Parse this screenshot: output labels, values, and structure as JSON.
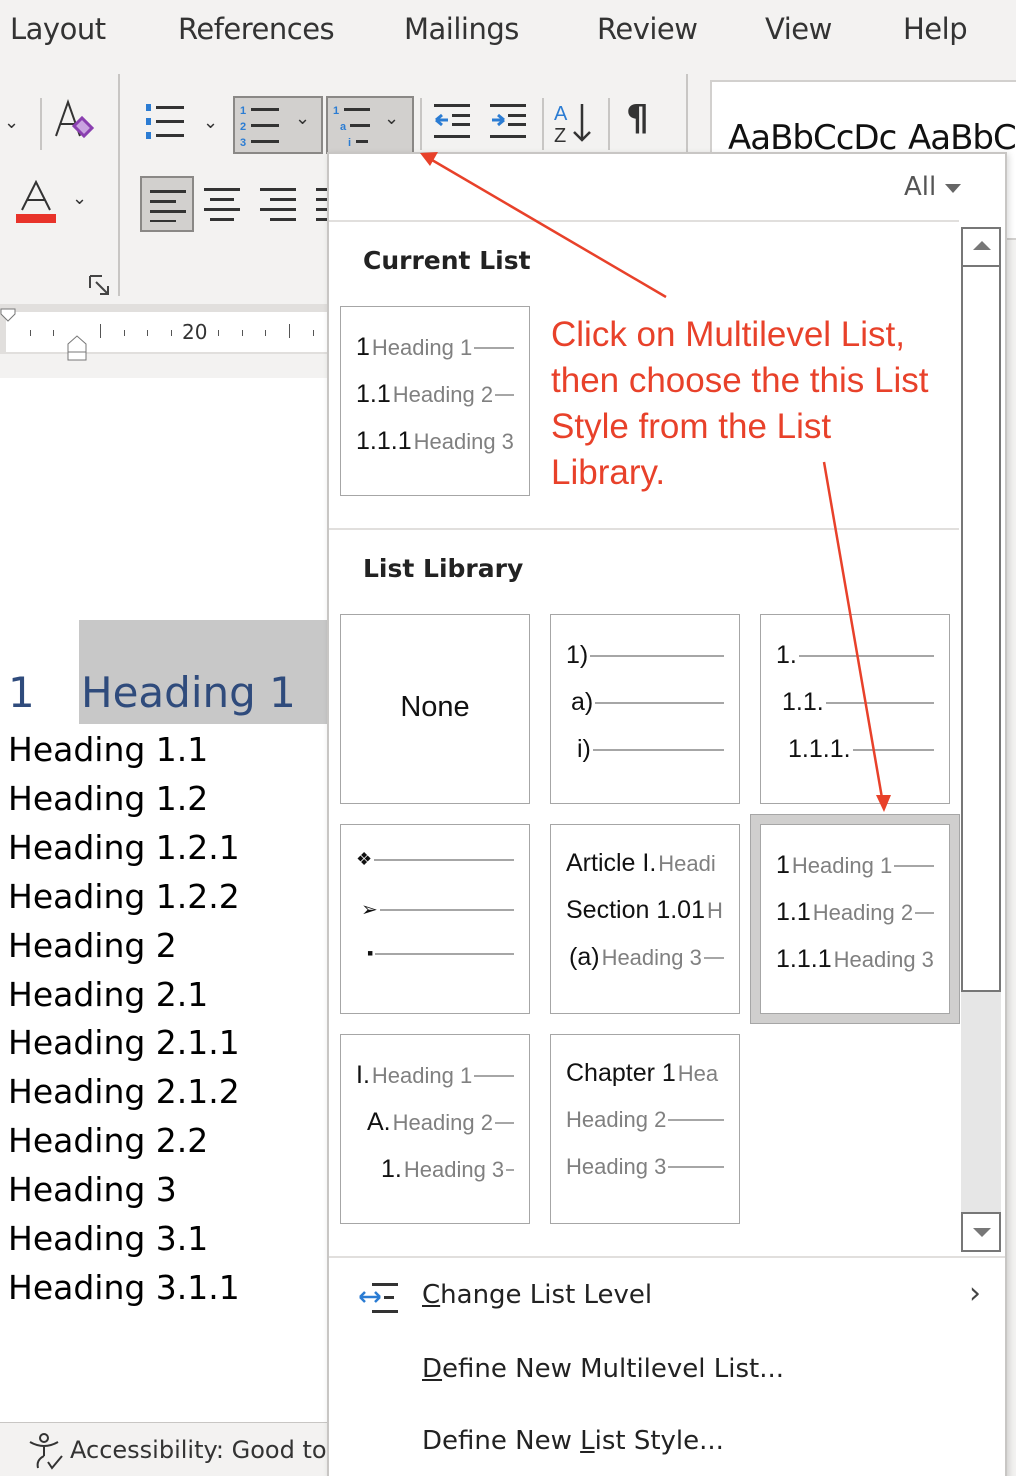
{
  "ribbon_tabs": [
    "Layout",
    "References",
    "Mailings",
    "Review",
    "View",
    "Help"
  ],
  "ribbon": {
    "buttons": {
      "clear_formatting": "Clear All Formatting",
      "font_color": "Font Color",
      "font_color_value": "#e8332a",
      "bullets": "Bullets",
      "numbering": "Numbering",
      "multilevel_list": "Multilevel List",
      "decrease_indent": "Decrease Indent",
      "increase_indent": "Increase Indent",
      "sort": "Sort",
      "show_hide": "Show/Hide ¶",
      "align_left": "Align Left",
      "center": "Center",
      "align_right": "Align Right",
      "justify": "Justify"
    },
    "styles_gallery": [
      "AaBbCcDc",
      "AaBbCc"
    ],
    "ruler_label": "20"
  },
  "document": {
    "heading1": {
      "number": "1",
      "text": "Heading 1"
    },
    "lines": [
      "Heading 1.1",
      "Heading 1.2",
      "Heading 1.2.1",
      "Heading 1.2.2",
      "Heading 2",
      "Heading 2.1",
      "Heading 2.1.1",
      "Heading 2.1.2",
      "Heading 2.2",
      "Heading 3",
      "Heading 3.1",
      "Heading 3.1.1"
    ]
  },
  "status_bar": {
    "accessibility": "Accessibility: Good to"
  },
  "multilevel_dropdown": {
    "filter": "All",
    "current_list_title": "Current List",
    "current_list": [
      {
        "num": "1",
        "text": "Heading 1"
      },
      {
        "num": "1.1",
        "text": "Heading 2"
      },
      {
        "num": "1.1.1",
        "text": "Heading 3"
      }
    ],
    "library_title": "List Library",
    "library": {
      "none": "None",
      "paren": [
        "1)",
        "a)",
        "i)"
      ],
      "decimal": [
        "1.",
        "1.1.",
        "1.1.1."
      ],
      "bullets": [
        "❖",
        "➢",
        "▪"
      ],
      "article": [
        {
          "num": "Article I.",
          "text": "Headi"
        },
        {
          "num": "Section 1.01",
          "text": "H"
        },
        {
          "num": "(a)",
          "text": "Heading 3"
        }
      ],
      "heading_numbered": [
        {
          "num": "1",
          "text": "Heading 1"
        },
        {
          "num": "1.1",
          "text": "Heading 2"
        },
        {
          "num": "1.1.1",
          "text": "Heading 3"
        }
      ],
      "outline": [
        {
          "num": "I.",
          "text": "Heading 1"
        },
        {
          "num": "A.",
          "text": "Heading 2"
        },
        {
          "num": "1.",
          "text": "Heading 3"
        }
      ],
      "chapter": [
        {
          "num": "Chapter 1",
          "text": "Hea"
        },
        {
          "num": "",
          "text": "Heading 2"
        },
        {
          "num": "",
          "text": "Heading 3"
        }
      ]
    },
    "selected_style": "heading_numbered",
    "menu": {
      "change_level": {
        "accel": "C",
        "rest": "hange List Level"
      },
      "define_multilevel": {
        "accel": "D",
        "rest": "efine New Multilevel List..."
      },
      "define_style": {
        "pre": "Define New ",
        "accel": "L",
        "rest": "ist Style..."
      }
    }
  },
  "annotation": {
    "text": "Click on Multilevel List, then choose the this List Style from the List Library.",
    "color": "#e8412a"
  }
}
